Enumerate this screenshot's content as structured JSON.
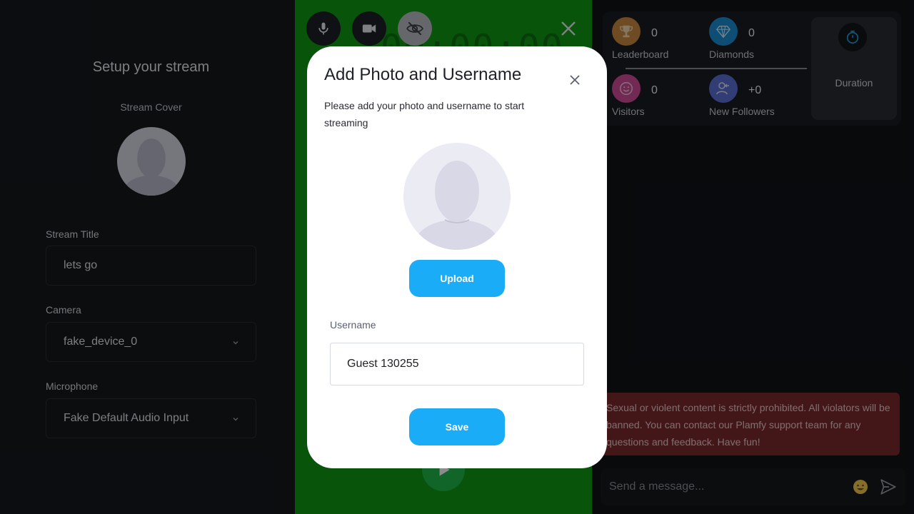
{
  "setup": {
    "title": "Setup your stream",
    "cover_label": "Stream Cover",
    "stream_title_label": "Stream Title",
    "stream_title_value": "lets go",
    "camera_label": "Camera",
    "camera_value": "fake_device_0",
    "microphone_label": "Microphone",
    "microphone_value": "Fake Default Audio Input"
  },
  "stage": {
    "timer_text": "00:00:00",
    "controls": [
      "microphone-icon",
      "video-camera-icon",
      "eye-off-icon"
    ],
    "background_color": "#0f9a14"
  },
  "stats": {
    "leaderboard": {
      "value": "0",
      "label": "Leaderboard"
    },
    "diamonds": {
      "value": "0",
      "label": "Diamonds"
    },
    "visitors": {
      "value": "0",
      "label": "Visitors"
    },
    "new_followers": {
      "value": "+0",
      "label": "New Followers"
    },
    "duration_label": "Duration"
  },
  "notice": {
    "text": "Sexual or violent content is strictly prohibited. All violators will be banned. You can contact our Plamfy support team for any questions and feedback. Have fun!"
  },
  "chat": {
    "placeholder": "Send a message..."
  },
  "modal": {
    "title": "Add Photo and Username",
    "description": "Please add your photo and username to start streaming",
    "upload_label": "Upload",
    "username_label": "Username",
    "username_value": "Guest 130255",
    "save_label": "Save"
  },
  "colors": {
    "accent": "#1aacf6",
    "notice_bg": "#7a2a2c",
    "leaderboard": "#c8893f",
    "diamonds": "#1b8fd6",
    "visitors": "#d04e9c",
    "new_followers": "#5b6fd8"
  }
}
